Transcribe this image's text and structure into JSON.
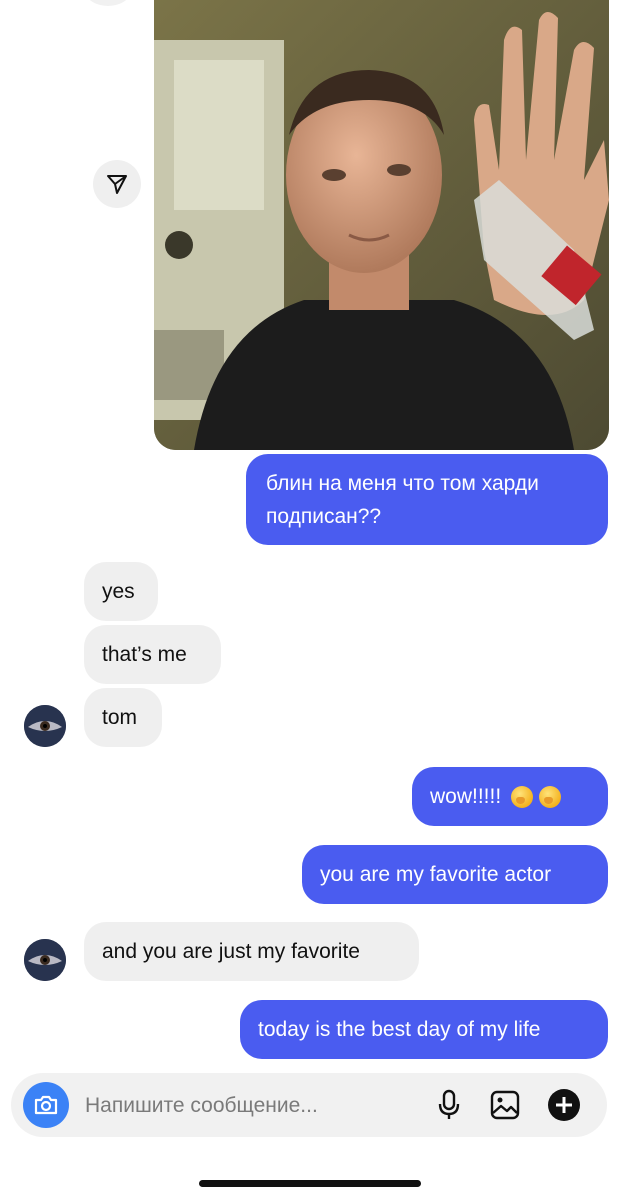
{
  "thread": {
    "shared_photo_alt": "",
    "messages": [
      {
        "from": "me",
        "text": "блин на меня что том харди подписан??"
      },
      {
        "from": "them",
        "text": "yes"
      },
      {
        "from": "them",
        "text": "that’s me"
      },
      {
        "from": "them",
        "text": "tom"
      },
      {
        "from": "me",
        "text": "wow!!!!!",
        "emoji": [
          "hand-over-mouth-emoji",
          "hand-over-mouth-emoji"
        ]
      },
      {
        "from": "me",
        "text": "you are my favorite actor"
      },
      {
        "from": "them",
        "text": "and you are just my favorite"
      },
      {
        "from": "me",
        "text": "today is the best day of my life"
      }
    ]
  },
  "composer": {
    "placeholder": "Напишите сообщение...",
    "icons": [
      "camera-icon",
      "microphone-icon",
      "gallery-icon",
      "plus-icon"
    ]
  },
  "colors": {
    "outgoing_bubble": "#4a5cf0",
    "incoming_bubble": "#efefef",
    "camera_button": "#3b82f6"
  }
}
